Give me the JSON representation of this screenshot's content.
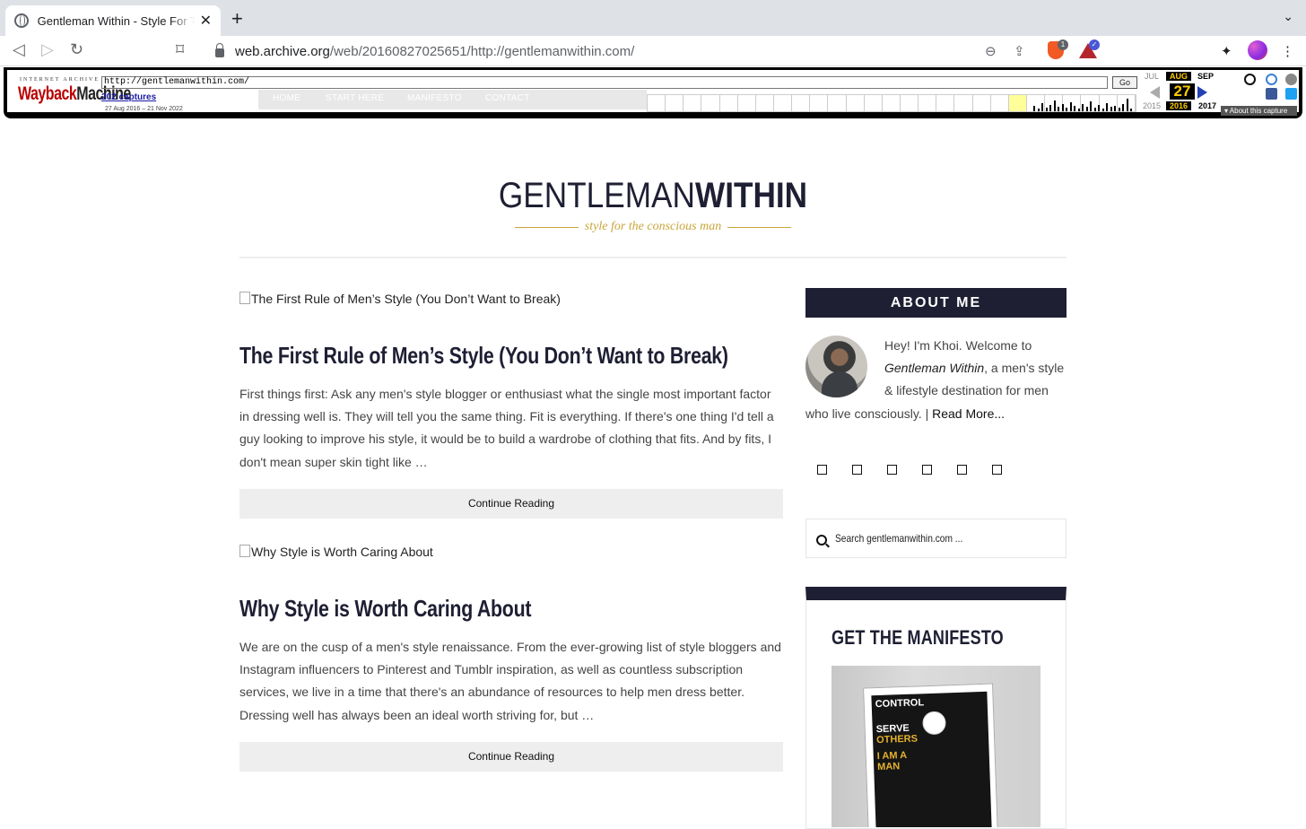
{
  "browser": {
    "tab_title": "Gentleman Within - Style For The Conscious Man",
    "url_host": "web.archive.org",
    "url_path": "/web/20160827025651/http://gentlemanwithin.com/",
    "brave_badge": "1"
  },
  "wayback": {
    "ia_label": "INTERNET ARCHIVE",
    "logo_a": "Wayback",
    "logo_b": "Machine",
    "url_value": "http://gentlemanwithin.com/",
    "go_label": "Go",
    "captures": "202 captures",
    "date_range": "27 Aug 2016 – 21 Nov 2022",
    "ghost_nav": [
      "HOME",
      "START HERE",
      "MANIFESTO",
      "CONTACT"
    ],
    "prev_month": "JUL",
    "cur_month": "AUG",
    "next_month": "SEP",
    "day": "27",
    "prev_year": "2015",
    "cur_year": "2016",
    "next_year": "2017",
    "about_capture": "▾ About this capture",
    "highlight_month_index": 20
  },
  "site": {
    "logo_light": "GENTLEMAN",
    "logo_bold": "WITHIN",
    "tagline": "style for the conscious man"
  },
  "posts": [
    {
      "img_alt": "The First Rule of Men’s Style (You Don’t Want to Break)",
      "title": "The First Rule of Men’s Style (You Don’t Want to Break)",
      "excerpt": "First things first: Ask any men's style blogger or enthusiast what the single most important factor in dressing well is. They will tell you the same thing. Fit is everything. If there's one thing I'd tell a guy looking to improve his style, it would be to build a wardrobe of clothing that fits. And by fits, I don't mean super skin tight like …",
      "cta": "Continue Reading"
    },
    {
      "img_alt": "Why Style is Worth Caring About",
      "title": "Why Style is Worth Caring About",
      "excerpt": "We are on the cusp of a men's style renaissance. From the ever-growing list of style bloggers and Instagram influencers to Pinterest and Tumblr inspiration, as well as countless subscription services, we live in a time that there's an abundance of resources to help men dress better. Dressing well has always been an ideal worth striving for, but …",
      "cta": "Continue Reading"
    }
  ],
  "sidebar": {
    "about_heading": "ABOUT ME",
    "about_intro": "Hey! I'm Khoi. Welcome to ",
    "about_em": "Gentleman Within",
    "about_rest": ", a men's style & lifestyle destination for men who live consciously. | ",
    "read_more": "Read More...",
    "search_placeholder": "Search gentlemanwithin.com ...",
    "manifesto_title": "GET THE MANIFESTO"
  },
  "colors": {
    "navy": "#1e1f33",
    "gold": "#c9a53a"
  }
}
